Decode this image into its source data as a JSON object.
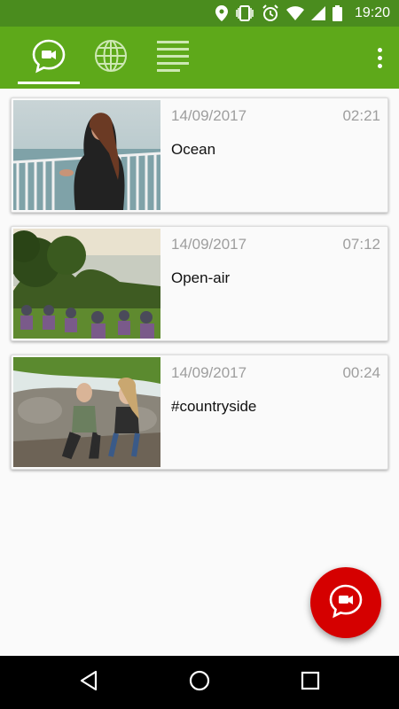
{
  "status_bar": {
    "time": "19:20",
    "icons": [
      "location-icon",
      "vibrate-icon",
      "alarm-icon",
      "wifi-icon",
      "signal-icon",
      "battery-icon"
    ]
  },
  "app_bar": {
    "tabs": [
      {
        "icon": "video-chat-icon",
        "selected": true
      },
      {
        "icon": "globe-icon",
        "selected": false
      },
      {
        "icon": "list-icon",
        "selected": false
      }
    ],
    "menu_icon": "more-vert-icon",
    "color": "#5ea91a"
  },
  "videos": [
    {
      "date": "14/09/2017",
      "duration": "02:21",
      "title": "Ocean"
    },
    {
      "date": "14/09/2017",
      "duration": "07:12",
      "title": "Open-air"
    },
    {
      "date": "14/09/2017",
      "duration": "00:24",
      "title": "#countryside"
    }
  ],
  "fab": {
    "icon": "video-chat-icon",
    "color": "#d50000"
  },
  "nav_bar": {
    "buttons": [
      "back-icon",
      "home-icon",
      "recents-icon"
    ]
  }
}
